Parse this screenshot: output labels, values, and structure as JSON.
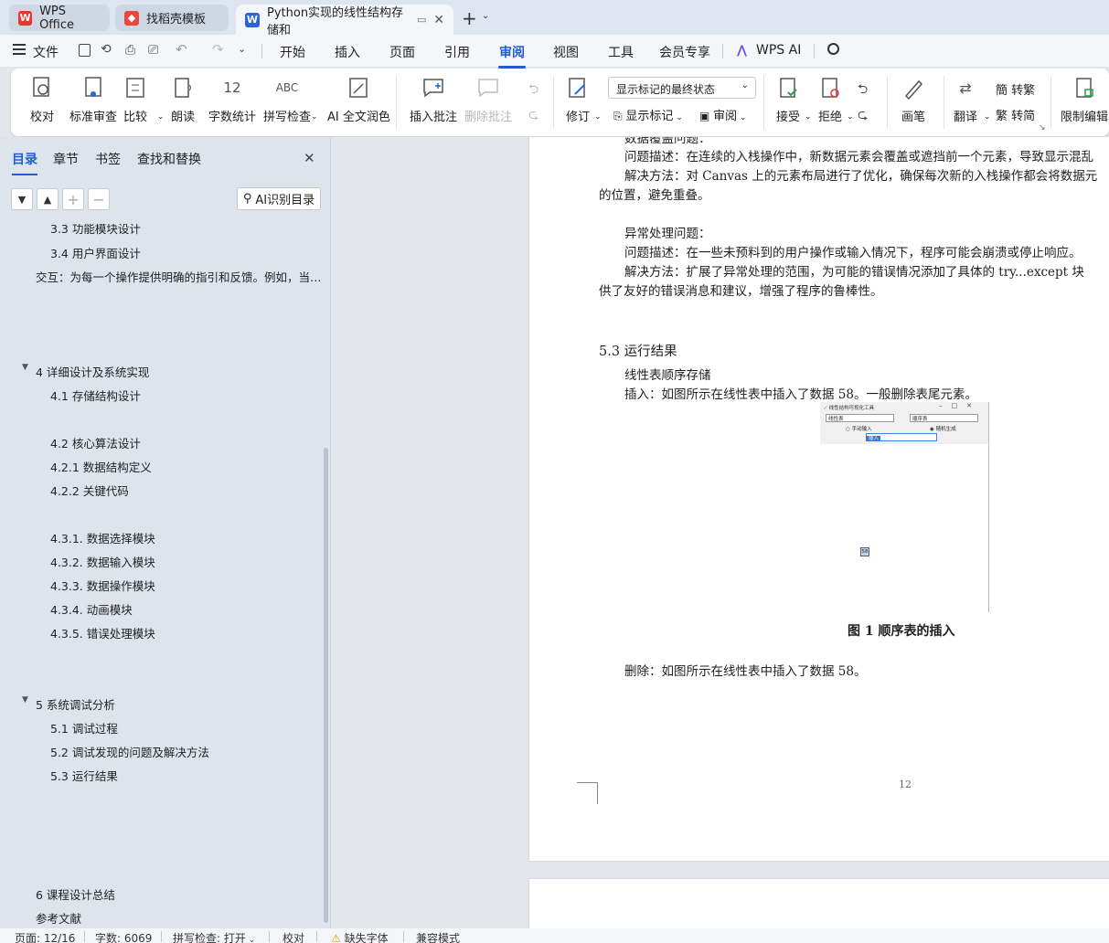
{
  "tabs": [
    {
      "label": "WPS Office",
      "icon": "wps-logo-icon"
    },
    {
      "label": "找稻壳模板",
      "icon": "docer-icon"
    },
    {
      "label": "Python实现的线性结构存储和",
      "icon": "word-doc-icon"
    }
  ],
  "menu": {
    "file": "文件",
    "items": [
      "开始",
      "插入",
      "页面",
      "引用",
      "审阅",
      "视图",
      "工具",
      "会员专享"
    ],
    "active": "审阅",
    "wps_ai": "WPS AI"
  },
  "ribbon": {
    "proofread": "校对",
    "standard_review": "标准审查",
    "compare": "比较",
    "read_aloud": "朗读",
    "word_count": "字数统计",
    "spell_check": "拼写检查",
    "ai_polish": "AI 全文润色",
    "insert_comment": "插入批注",
    "delete_comment": "删除批注",
    "track_changes": "修订",
    "display_select": "显示标记的最终状态",
    "show_markup": "显示标记",
    "review": "审阅",
    "accept": "接受",
    "reject": "拒绝",
    "pen": "画笔",
    "translate": "翻译",
    "to_traditional": "转繁",
    "to_simplified": "转简",
    "restrict_edit": "限制编辑"
  },
  "sidebar": {
    "tabs": [
      "目录",
      "章节",
      "书签",
      "查找和替换"
    ],
    "ai_button": "AI识别目录",
    "toc": [
      {
        "label": "3.3  功能模块设计"
      },
      {
        "label": "3.4  用户界面设计"
      },
      {
        "label": "交互：为每一个操作提供明确的指引和反馈。例如，当…"
      },
      {
        "label": "4  详细设计及系统实现"
      },
      {
        "label": "4.1  存储结构设计"
      },
      {
        "label": "4.2  核心算法设计"
      },
      {
        "label": "4.2.1 数据结构定义"
      },
      {
        "label": "4.2.2 关键代码"
      },
      {
        "label": "4.3.1. 数据选择模块"
      },
      {
        "label": "4.3.2. 数据输入模块"
      },
      {
        "label": "4.3.3. 数据操作模块"
      },
      {
        "label": "4.3.4. 动画模块"
      },
      {
        "label": "4.3.5. 错误处理模块"
      },
      {
        "label": "5  系统调试分析"
      },
      {
        "label": "5.1  调试过程"
      },
      {
        "label": "5.2  调试发现的问题及解决方法"
      },
      {
        "label": "5.3  运行结果"
      },
      {
        "label": "6  课程设计总结"
      },
      {
        "label": "参考文献"
      }
    ]
  },
  "document": {
    "lines": [
      "数据覆盖问题：",
      "问题描述：在连续的入栈操作中，新数据元素会覆盖或遮挡前一个元素，导致显示混乱",
      "解决方法：对 Canvas 上的元素布局进行了优化，确保每次新的入栈操作都会将数据元",
      "的位置，避免重叠。",
      "异常处理问题：",
      "问题描述：在一些未预料到的用户操作或输入情况下，程序可能会崩溃或停止响应。",
      "解决方法：扩展了异常处理的范围，为可能的错误情况添加了具体的 try...except 块",
      "供了友好的错误消息和建议，增强了程序的鲁棒性。"
    ],
    "heading": "5.3  运行结果",
    "subheading": "线性表顺序存储",
    "insert_text": "插入：如图所示在线性表中插入了数据 58。一般删除表尾元素。",
    "figure": {
      "window_title": "线性结构可视化工具",
      "select1": "线性表",
      "select2": "顺序表",
      "radio1": "手动输入",
      "radio2": "随机生成",
      "input_value": "插入",
      "node_value": "58"
    },
    "caption": "图 1  顺序表的插入",
    "delete_text": "删除：如图所示在线性表中插入了数据 58。",
    "page_number": "12"
  },
  "status": {
    "page": "页面: 12/16",
    "words": "字数: 6069",
    "spell": "拼写检查: 打开",
    "proof": "校对",
    "missing_font": "缺失字体",
    "compat": "兼容模式"
  },
  "colors": {
    "accent": "#1e5dd6",
    "wps_red": "#e6362d",
    "word_blue": "#2b64d9"
  }
}
